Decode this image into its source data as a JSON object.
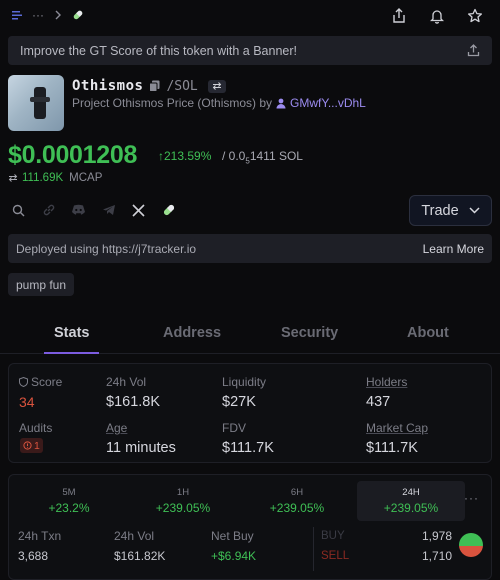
{
  "topbar": {
    "crumb_sep": "···",
    "icons": [
      "menu-icon",
      "more-icon",
      "chevron-right-icon",
      "pill-icon",
      "share-icon",
      "bell-icon",
      "star-icon"
    ]
  },
  "banner": {
    "text": "Improve the GT Score of this token with a Banner!"
  },
  "token": {
    "name": "Othismos",
    "pair": "/SOL",
    "subtitle_prefix": "Project Othismos Price (Othismos) by",
    "creator": "GMwfY...vDhL"
  },
  "price": {
    "usd": "$0.0001208",
    "change": "213.59%",
    "sol_prefix": "/ 0.0",
    "sol_sub": "5",
    "sol_suffix": "1411 SOL",
    "mcap_value": "111.69K",
    "mcap_label": "MCAP"
  },
  "trade": {
    "label": "Trade"
  },
  "deployed": {
    "text": "Deployed using https://j7tracker.io",
    "link": "Learn More"
  },
  "tag": {
    "label": "pump fun"
  },
  "tabs": [
    {
      "label": "Stats"
    },
    {
      "label": "Address"
    },
    {
      "label": "Security"
    },
    {
      "label": "About"
    }
  ],
  "stats": {
    "score_label": "Score",
    "score_value": "34",
    "vol_label": "24h Vol",
    "vol_value": "$161.8K",
    "liq_label": "Liquidity",
    "liq_value": "$27K",
    "holders_label": "Holders",
    "holders_value": "437",
    "audits_label": "Audits",
    "audits_value": "1",
    "age_label": "Age",
    "age_value": "11 minutes",
    "fdv_label": "FDV",
    "fdv_value": "$111.7K",
    "mcap_label": "Market Cap",
    "mcap_value": "$111.7K"
  },
  "timeframes": [
    {
      "label": "5M",
      "value": "+23.2%"
    },
    {
      "label": "1H",
      "value": "+239.05%"
    },
    {
      "label": "6H",
      "value": "+239.05%"
    },
    {
      "label": "24H",
      "value": "+239.05%"
    }
  ],
  "txn": {
    "txn_label": "24h Txn",
    "txn_value": "3,688",
    "vol_label": "24h Vol",
    "vol_value": "$161.82K",
    "netbuy_label": "Net Buy",
    "netbuy_value": "+$6.94K",
    "buy_label": "BUY",
    "buy_value": "1,978",
    "sell_label": "SELL",
    "sell_value": "1,710",
    "buy_fraction": 0.536
  },
  "colors": {
    "accent_green": "#3fbf55",
    "accent_red": "#d9533e",
    "accent_purple": "#7c5ce0"
  }
}
